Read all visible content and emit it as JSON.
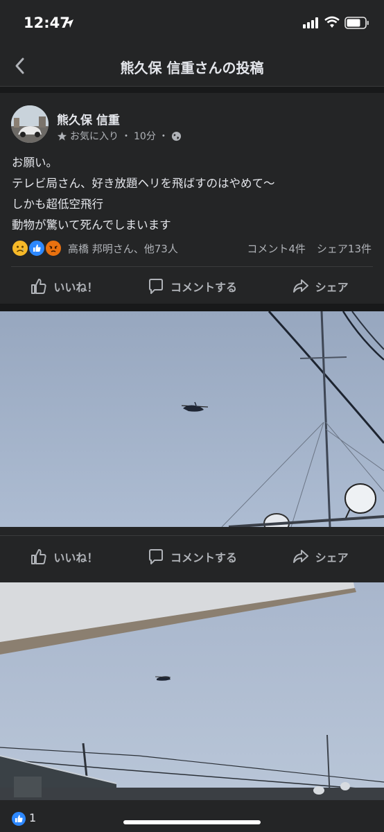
{
  "status": {
    "time": "12:47"
  },
  "nav": {
    "title": "熊久保 信重さんの投稿"
  },
  "post": {
    "author": "熊久保 信重",
    "meta_favorites": "お気に入り",
    "meta_sep1": "・",
    "meta_time": "10分",
    "meta_sep2": "・",
    "lines": [
      "お願い。",
      "テレビ局さん、好き放題ヘリを飛ばすのはやめて〜",
      "しかも超低空飛行",
      "動物が驚いて死んでしまいます"
    ],
    "reaction_names": "高橋 邦明さん、他73人",
    "comments": "コメント4件",
    "shares": "シェア13件"
  },
  "actions": {
    "like": "いいね！",
    "comment": "コメントする",
    "share": "シェア"
  },
  "photo_actions": {
    "like": "いいね！",
    "comment": "コメントする",
    "share": "シェア"
  },
  "bottom": {
    "like_count": "1"
  },
  "colors": {
    "accent": "#2d88ff",
    "background": "#18191a",
    "card": "#242526",
    "sky": "#a5b6cf"
  },
  "icons": [
    "location-arrow-icon",
    "signal-icon",
    "wifi-icon",
    "battery-icon",
    "back-chevron-icon",
    "star-icon",
    "globe-icon",
    "sad-reaction-icon",
    "like-reaction-icon",
    "angry-reaction-icon",
    "thumbs-up-icon",
    "comment-bubble-icon",
    "share-arrow-icon"
  ]
}
